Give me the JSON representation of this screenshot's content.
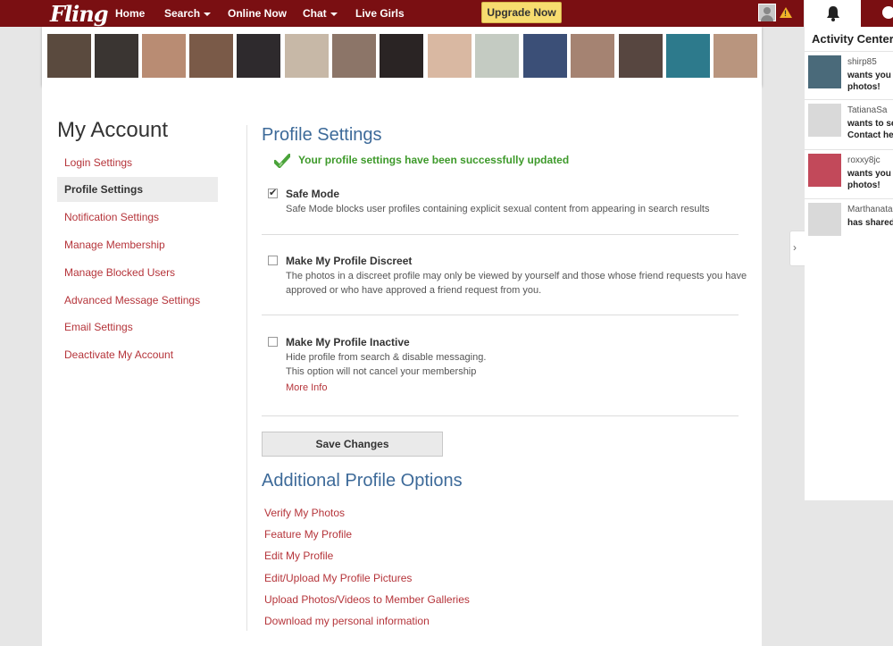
{
  "nav": {
    "logo": "Fling",
    "items": [
      "Home",
      "Search",
      "Online Now",
      "Chat",
      "Live Girls"
    ],
    "upgrade": "Upgrade Now",
    "warn_glyph": "!"
  },
  "photos": {
    "colors": [
      "#5a4a3e",
      "#3a3532",
      "#b98c73",
      "#7a5a48",
      "#2e2a2d",
      "#c7b8a7",
      "#8c7568",
      "#2a2424",
      "#d9b8a2",
      "#c4cbc2",
      "#3b4f77",
      "#a58372",
      "#574640",
      "#2d7a8c",
      "#b9957e"
    ]
  },
  "sidebar": {
    "title": "My Account",
    "items": [
      "Login Settings",
      "Profile Settings",
      "Notification Settings",
      "Manage Membership",
      "Manage Blocked Users",
      "Advanced Message Settings",
      "Email Settings",
      "Deactivate My Account"
    ]
  },
  "profile": {
    "title": "Profile Settings",
    "success": "Your profile settings have been successfully updated",
    "options": [
      {
        "title": "Safe Mode",
        "checked": true,
        "desc": "Safe Mode blocks user profiles containing explicit sexual content from appearing in search results"
      },
      {
        "title": "Make My Profile Discreet",
        "checked": false,
        "desc": "The photos in a discreet profile may only be viewed by yourself and those whose friend requests you have approved or who have approved a friend request from you."
      },
      {
        "title": "Make My Profile Inactive",
        "checked": false,
        "desc_line1": "Hide profile from search & disable messaging.",
        "desc_line2": "This option will not cancel your membership",
        "link": "More Info"
      }
    ],
    "save": "Save Changes"
  },
  "additional": {
    "title": "Additional Profile Options",
    "links": [
      "Verify My Photos",
      "Feature My Profile",
      "Edit My Profile",
      "Edit/Upload My Profile Pictures",
      "Upload Photos/Videos to Member Galleries",
      "Download my personal information"
    ]
  },
  "activity": {
    "title": "Activity Center",
    "items": [
      {
        "user": "shirp85",
        "line1": "wants you t",
        "line2": "photos!",
        "thumb": "#4a6a7a"
      },
      {
        "user": "TatianaSa",
        "line1": "wants to se",
        "line2": "Contact her",
        "thumb": "#d9d9d9"
      },
      {
        "user": "roxxy8jc",
        "line1": "wants you t",
        "line2": "photos!",
        "thumb": "#c2495a"
      },
      {
        "user": "Marthanata",
        "line1": "has shared",
        "line2": "",
        "thumb": "#d9d9d9"
      }
    ],
    "collapse_glyph": "›"
  }
}
